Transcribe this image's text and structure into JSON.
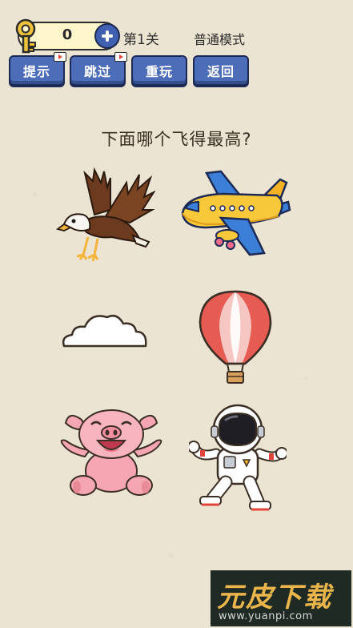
{
  "header": {
    "key_count": "0",
    "level": "第1关",
    "mode": "普通模式",
    "buttons": [
      {
        "label": "提示",
        "has_video": true
      },
      {
        "label": "跳过",
        "has_video": true
      },
      {
        "label": "重玩",
        "has_video": false
      },
      {
        "label": "返回",
        "has_video": false
      }
    ]
  },
  "question": "下面哪个飞得最高?",
  "options": [
    {
      "icon": "eagle-icon"
    },
    {
      "icon": "airplane-icon"
    },
    {
      "icon": "cloud-icon"
    },
    {
      "icon": "hot-air-balloon-icon"
    },
    {
      "icon": "pig-icon"
    },
    {
      "icon": "astronaut-icon"
    }
  ],
  "watermark": {
    "brand": "元皮下载",
    "url": "www.yuanpi.com"
  },
  "colors": {
    "background": "#ece4d2",
    "button_blue": "#4e6db8",
    "key_gold": "#f0c43a"
  }
}
